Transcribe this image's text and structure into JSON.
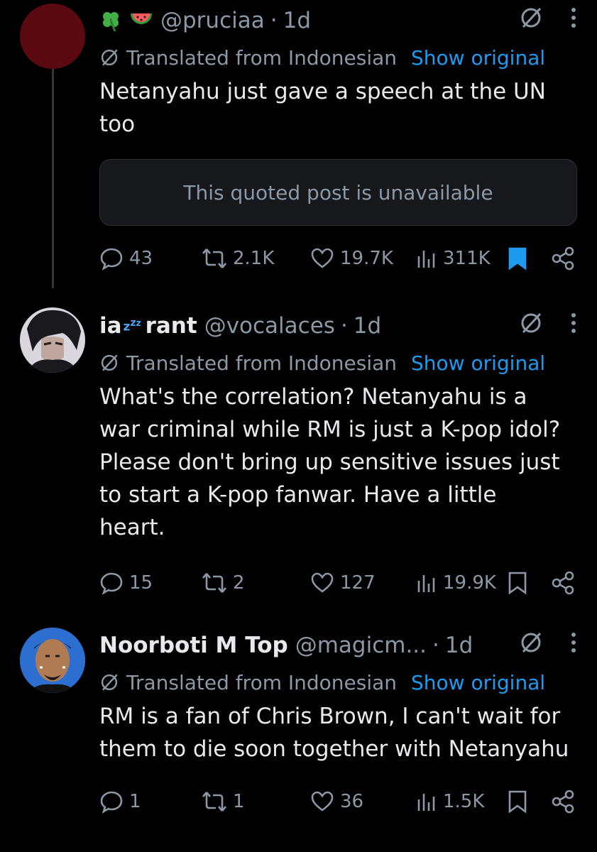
{
  "posts": [
    {
      "display_name": "",
      "emoji": [
        "clover-icon",
        "watermelon-icon"
      ],
      "handle": "@pruciaa",
      "time": "1d",
      "translated_label": "Translated from Indonesian",
      "show_original": "Show original",
      "text": "Netanyahu just gave a speech at the UN too",
      "quote": "This quoted post is unavailable",
      "replies": "43",
      "reposts": "2.1K",
      "likes": "19.7K",
      "views": "311K",
      "bookmarked": true
    },
    {
      "display_name": "ia",
      "name_suffix": "rant",
      "handle": "@vocalaces",
      "time": "1d",
      "translated_label": "Translated from Indonesian",
      "show_original": "Show original",
      "text": "What's the correlation? Netanyahu is a war criminal while RM is just a K-pop idol? Please don't bring up sensitive issues just to start a K-pop fanwar. Have a little heart.",
      "replies": "15",
      "reposts": "2",
      "likes": "127",
      "views": "19.9K",
      "bookmarked": false
    },
    {
      "display_name": "Noorboti M Top",
      "handle": "@magicm...",
      "time": "1d",
      "translated_label": "Translated from Indonesian",
      "show_original": "Show original",
      "text": "RM is a fan of Chris Brown, I can't wait for them to die soon together with Netanyahu",
      "replies": "1",
      "reposts": "1",
      "likes": "36",
      "views": "1.5K",
      "bookmarked": false
    }
  ],
  "colors": {
    "background": "#000000",
    "text": "#e7e9ea",
    "secondary": "#8b98a5",
    "link": "#1d9bf0",
    "avatar1": "#5a0a10"
  }
}
